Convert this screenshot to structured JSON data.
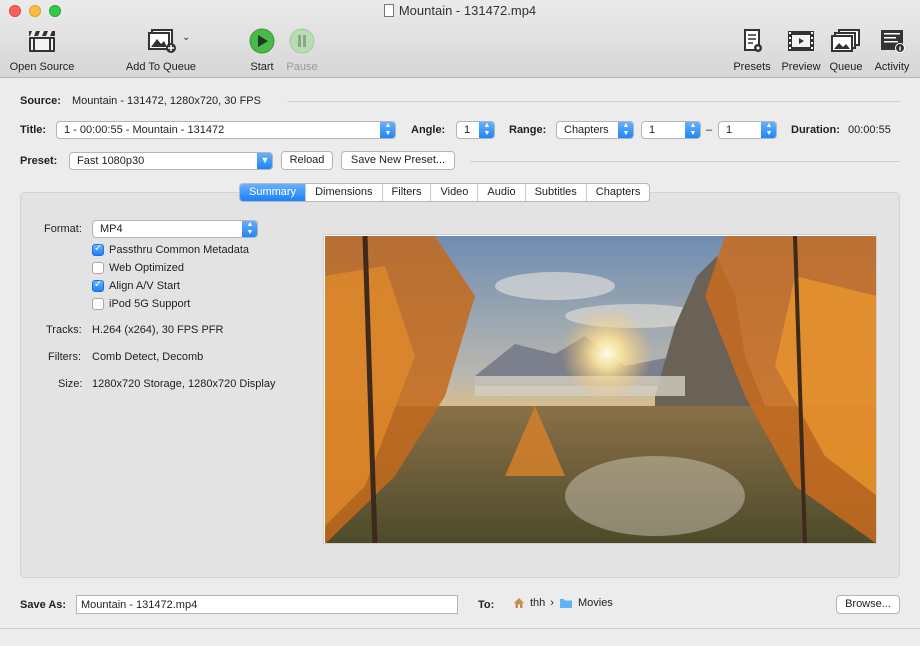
{
  "window": {
    "title": "Mountain - 131472.mp4"
  },
  "toolbar": {
    "open_source": "Open Source",
    "add_to_queue": "Add To Queue",
    "start": "Start",
    "pause": "Pause",
    "presets": "Presets",
    "preview": "Preview",
    "queue": "Queue",
    "activity": "Activity"
  },
  "source": {
    "label": "Source:",
    "value": "Mountain - 131472, 1280x720, 30 FPS"
  },
  "title_row": {
    "label": "Title:",
    "value": "1 - 00:00:55 - Mountain - 131472",
    "angle_label": "Angle:",
    "angle_value": "1",
    "range_label": "Range:",
    "range_type": "Chapters",
    "range_start": "1",
    "range_dash": "–",
    "range_end": "1",
    "duration_label": "Duration:",
    "duration_value": "00:00:55"
  },
  "preset": {
    "label": "Preset:",
    "value": "Fast 1080p30",
    "reload": "Reload",
    "save_new": "Save New Preset..."
  },
  "tabs": [
    "Summary",
    "Dimensions",
    "Filters",
    "Video",
    "Audio",
    "Subtitles",
    "Chapters"
  ],
  "summary": {
    "format_label": "Format:",
    "format_value": "MP4",
    "checkboxes": [
      {
        "label": "Passthru Common Metadata",
        "checked": true
      },
      {
        "label": "Web Optimized",
        "checked": false
      },
      {
        "label": "Align A/V Start",
        "checked": true
      },
      {
        "label": "iPod 5G Support",
        "checked": false
      }
    ],
    "tracks_label": "Tracks:",
    "tracks_value": "H.264 (x264), 30 FPS PFR",
    "filters_label": "Filters:",
    "filters_value": "Comb Detect, Decomb",
    "size_label": "Size:",
    "size_value": "1280x720 Storage, 1280x720 Display"
  },
  "save": {
    "label": "Save As:",
    "filename": "Mountain - 131472.mp4",
    "to_label": "To:",
    "path_home": "thh",
    "path_sep": "›",
    "path_folder": "Movies",
    "browse": "Browse..."
  }
}
